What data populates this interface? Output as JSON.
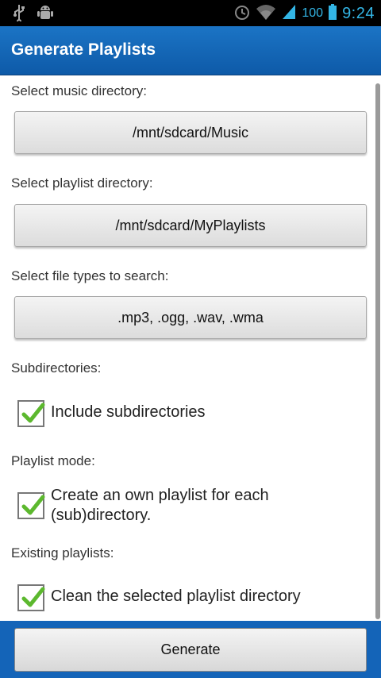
{
  "status_bar": {
    "left_icons": [
      "usb-icon",
      "android-debug-icon"
    ],
    "right_icons": [
      "alarm-icon",
      "wifi-icon",
      "signal-icon",
      "battery-icon"
    ],
    "battery": "100",
    "time": "9:24"
  },
  "app": {
    "title": "Generate Playlists"
  },
  "music_dir": {
    "label": "Select music directory:",
    "value": "/mnt/sdcard/Music"
  },
  "playlist_dir": {
    "label": "Select playlist directory:",
    "value": "/mnt/sdcard/MyPlaylists"
  },
  "file_types": {
    "label": "Select file types to search:",
    "value": ".mp3, .ogg, .wav, .wma"
  },
  "subdirectories": {
    "label": "Subdirectories:",
    "option": "Include subdirectories",
    "checked": true
  },
  "playlist_mode": {
    "label": "Playlist mode:",
    "option_line1": "Create an own playlist for each",
    "option_line2": "(sub)directory.",
    "checked": true
  },
  "existing": {
    "label": "Existing playlists:",
    "option": "Clean the selected playlist directory",
    "checked": true
  },
  "footer": {
    "generate_label": "Generate"
  },
  "colors": {
    "accent_blue": "#1464b8",
    "status_blue": "#33b5e5",
    "check_green": "#5cb82e"
  }
}
